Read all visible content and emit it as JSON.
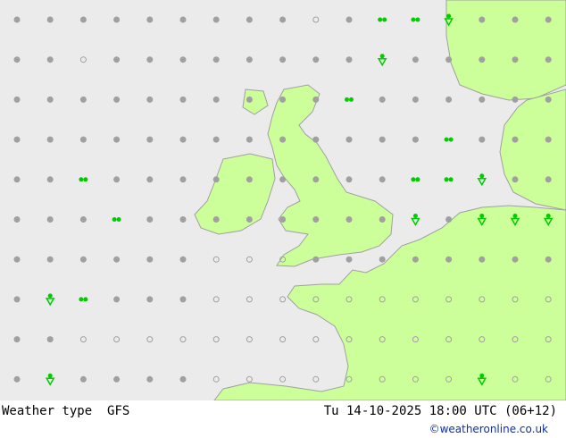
{
  "title": "Weather type",
  "model": "GFS",
  "valid_time": "Tu 14-10-2025 18:00 UTC (06+12)",
  "credit": "©weatheronline.co.uk",
  "colors": {
    "sea": "#ebebeb",
    "land": "#c8ff a0",
    "land_fill": "#ccff99",
    "coast": "#a0a0a0",
    "symbol_grey": "#a0a0a0",
    "symbol_green": "#00cc00"
  },
  "legend_codes": {
    "d": "dry/overcast",
    "o": "clear/fair",
    "z": "drizzle",
    "s": "rain shower"
  },
  "symbol_grid": [
    "dddddddddodzzsddd",
    "ddoddddddddsddddd",
    "ddddddddddzdddddd",
    "dddddddddddddzddd",
    "ddzdddddddddzzsdd",
    "dddzddddddddsdsss",
    "ddddddooodddddddd",
    "dszdddooooooooooo",
    "ddooooooooooooooo",
    "dsddddoooooooosoo"
  ]
}
